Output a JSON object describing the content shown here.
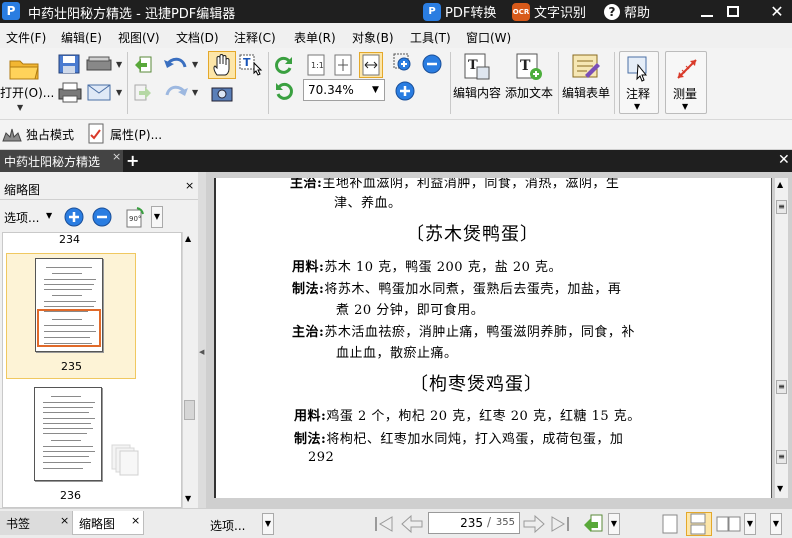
{
  "titlebar": {
    "logo": "P",
    "title": "中药壮阳秘方精选 - 迅捷PDF编辑器",
    "pdf_convert": "PDF转换",
    "ocr_badge": "OCR",
    "ocr": "文字识别",
    "help": "帮助"
  },
  "menu": [
    "文件(F)",
    "编辑(E)",
    "视图(V)",
    "文档(D)",
    "注释(C)",
    "表单(R)",
    "对象(B)",
    "工具(T)",
    "窗口(W)"
  ],
  "toolbar": {
    "open": "打开(O)...",
    "zoom": "70.34%",
    "edit_content": "编辑内容",
    "add_text": "添加文本",
    "edit_form": "编辑表单",
    "annotate": "注释",
    "measure": "测量",
    "fit_label": "1:1"
  },
  "toolbar2": {
    "exclusive_mode": "独占模式",
    "properties": "属性(P)..."
  },
  "tabs": {
    "doc": "中药壮阳秘方精选",
    "close": "×",
    "new": "+"
  },
  "left_panel": {
    "title": "缩略图",
    "close": "×",
    "options": "选项...",
    "rotate": "90°",
    "pages": [
      {
        "num": "234"
      },
      {
        "num": "235"
      },
      {
        "num": "236"
      }
    ]
  },
  "document": {
    "top_line1_label": "主治:",
    "top_line1": "主地补血滋阴，利益消肿，同食，消热，滋阴，生",
    "top_line2": "津、养血。",
    "heading1": "〔苏木煲鸭蛋〕",
    "l1_label": "用料:",
    "l1": "苏木 10 克，鸭蛋 200 克，盐 20 克。",
    "l2_label": "制法:",
    "l2": "将苏木、鸭蛋加水同煮，蛋熟后去蛋壳，加盐，再",
    "l3": "煮 20 分钟，即可食用。",
    "l4_label": "主治:",
    "l4": "苏木活血祛瘀，消肿止痛，鸭蛋滋阴养肺，同食，补",
    "l5": "血止血，散瘀止痛。",
    "heading2": "〔枸枣煲鸡蛋〕",
    "l6_label": "用料:",
    "l6": "鸡蛋 2 个，枸杞 20 克，红枣 20 克，红糖 15 克。",
    "l7_label": "制法:",
    "l7": "将枸杞、红枣加水同炖，打入鸡蛋，成荷包蛋，加",
    "page_no": "292"
  },
  "bottom": {
    "tab_bookmarks": "书签",
    "tab_thumbs": "缩略图",
    "close": "×",
    "options": "选项...",
    "page_current": "235",
    "page_total": "355",
    "page_sep": "/"
  },
  "colors": {
    "titlebar": "#1f1f1f",
    "accent_orange": "#ff9a1f",
    "selected_thumb": "#fdf3d6",
    "blue_icon": "#2a7de1"
  }
}
